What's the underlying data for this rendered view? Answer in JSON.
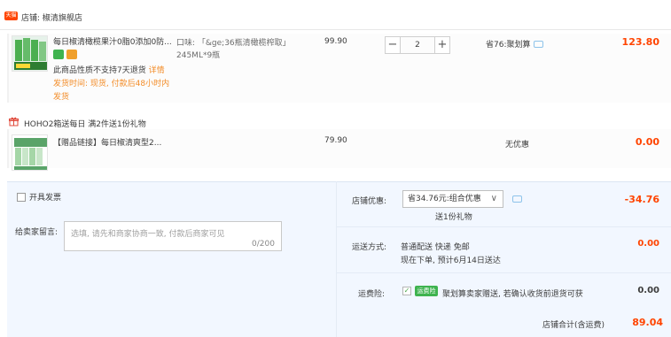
{
  "shop": {
    "badge": "天猫",
    "name": "店铺: 椒清旗舰店"
  },
  "item1": {
    "title": "每日椒清橄榄果汁0脂0添加0防...",
    "note_prefix": "此商品性质不支持7天退货",
    "note_link": "详情",
    "ship_note": "发货时间: 现货, 付款后48小时内发货",
    "spec": "口味: 「&ge;36瓶清橄榄榨取」245ML*9瓶",
    "price": "99.90",
    "qty_minus": "−",
    "qty_value": "2",
    "qty_plus": "+",
    "promo": "省76:聚划算",
    "subtotal": "123.80"
  },
  "gift": {
    "header": "HOHO2箱送每日   满2件送1份礼物",
    "title": "【赠品链接】每日椒清爽型2...",
    "price": "79.90",
    "promo": "无优惠",
    "subtotal": "0.00"
  },
  "order": {
    "invoice_label": "开具发票",
    "message_label": "给卖家留言:",
    "message_placeholder": "选填, 请先和商家协商一致, 付款后商家可见",
    "message_count": "0/200",
    "shop_discount_label": "店铺优惠:",
    "shop_discount_value": "省34.76元:组合优惠",
    "shop_discount_chevron": "∨",
    "shop_discount_note": "送1份礼物",
    "shop_discount_amount": "-34.76",
    "shipping_label": "运送方式:",
    "shipping_option": "普通配送 快递 免邮",
    "shipping_time": "现在下单, 预计6月14日送达",
    "shipping_amount": "0.00",
    "insurance_label": "运费险:",
    "insurance_check": "✓",
    "insurance_badge": "运费险",
    "insurance_text": "聚划算卖家赠送, 若确认收货前退货可获",
    "insurance_amount": "0.00",
    "total_label": "店铺合计(含运费)",
    "total_amount": "89.04"
  },
  "colors": {
    "accent": "#ff4400",
    "orange_note": "#f38d29",
    "panel_bg": "#f2f7ff"
  }
}
